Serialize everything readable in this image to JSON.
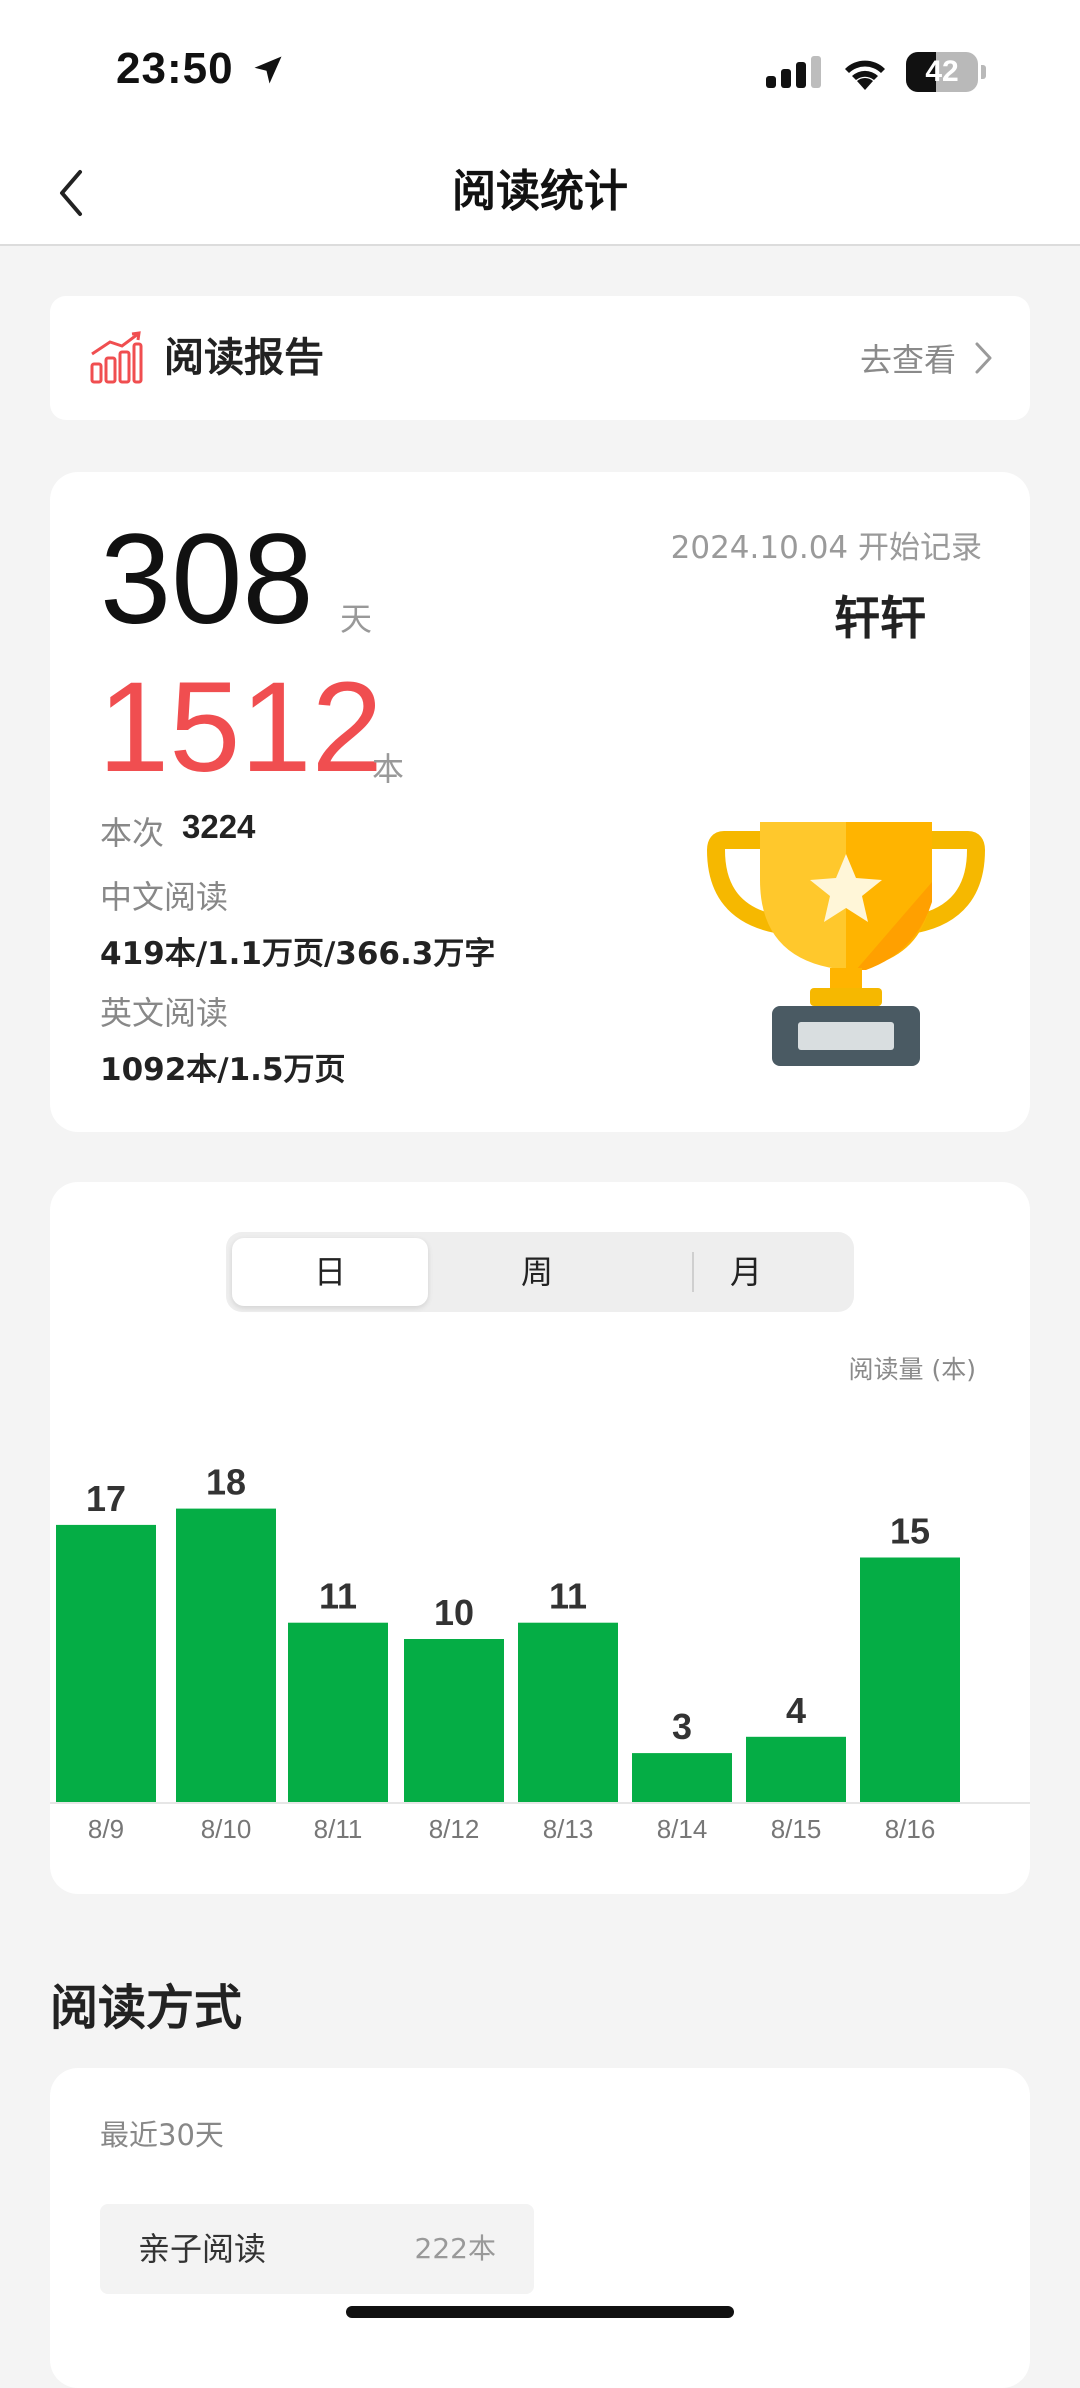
{
  "status_bar": {
    "time": "23:50",
    "battery_level": 42,
    "battery_text": "42",
    "icons": [
      "location-arrow-icon",
      "cellular-signal-icon",
      "wifi-icon",
      "battery-icon"
    ]
  },
  "nav": {
    "title": "阅读统计",
    "back_icon": "chevron-left-icon"
  },
  "report": {
    "title": "阅读报告",
    "link_text": "去查看",
    "icon": "bar-chart-icon",
    "accent": "#f04e50"
  },
  "summary": {
    "days": "308",
    "days_unit": "天",
    "books": "1512",
    "books_unit": "本",
    "books_color": "#f04e50",
    "start_date": "2024.10.04 开始记录",
    "user_name": "轩轩",
    "session_label": "本次",
    "session_value": "3224",
    "chinese_label": "中文阅读",
    "chinese_value": "419本/1.1万页/366.3万字",
    "english_label": "英文阅读",
    "english_value": "1092本/1.5万页",
    "trophy_icon": "trophy-icon"
  },
  "period_tabs": {
    "items": [
      "日",
      "周",
      "月"
    ],
    "selected": "日"
  },
  "chart_data": {
    "type": "bar",
    "categories": [
      "8/9",
      "8/10",
      "8/11",
      "8/12",
      "8/13",
      "8/14",
      "8/15",
      "8/16"
    ],
    "values": [
      17,
      18,
      11,
      10,
      11,
      3,
      4,
      15
    ],
    "ylabel": "阅读量 (本)",
    "color": "#05ad45",
    "grid": false
  },
  "reading_mode": {
    "section_title": "阅读方式",
    "period": "最近30天",
    "items": [
      {
        "name": "亲子阅读",
        "count": "222本"
      }
    ]
  }
}
